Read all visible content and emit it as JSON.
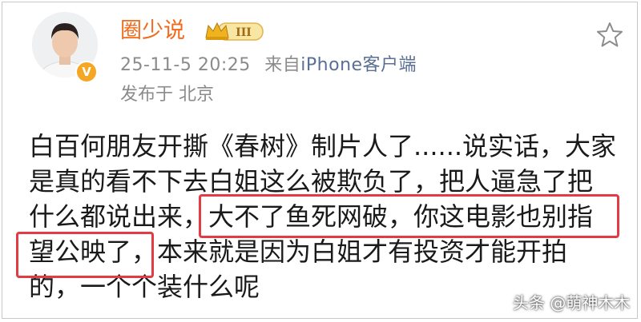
{
  "post": {
    "username": "圈少说",
    "vip_badge": "III",
    "timestamp": "25-11-5 20:25",
    "source_prefix": "来自",
    "source_device": "iPhone客户端",
    "location": "发布于 北京",
    "lines": [
      "白百何朋友开撕《春树》制片人了......说实话，大家",
      "是真的看不下去白姐这么被欺负了，把人逼急了把",
      "什么都说出来，大不了鱼死网破，你这电影也别指",
      "望公映了，本来就是因为白姐才有投资才能开拍",
      "的，一个个装什么呢"
    ]
  },
  "watermark": "头条 @萌神木木",
  "colors": {
    "username": "#f26a1b",
    "meta": "#8b8b8b",
    "device_link": "#5b6f94",
    "highlight_box": "#e23b43"
  },
  "icons": {
    "favorite": "star-outline-icon",
    "verified": "verified-v-icon",
    "vip": "crown-vip-badge-icon"
  }
}
